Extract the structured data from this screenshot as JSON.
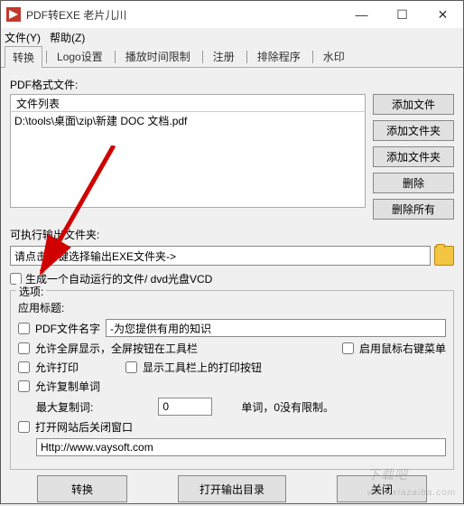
{
  "title": "PDF转EXE    老片儿川",
  "winbtns": {
    "min": "—",
    "max": "☐",
    "close": "✕"
  },
  "menu": {
    "file": "文件(Y)",
    "help": "帮助(Z)"
  },
  "tabs": [
    "转换",
    "Logo设置",
    "播放时间限制",
    "注册",
    "排除程序",
    "水印"
  ],
  "section1_label": "PDF格式文件:",
  "file_list_header": "文件列表",
  "file_list_items": [
    "D:\\tools\\桌面\\zip\\新建 DOC 文档.pdf"
  ],
  "side_buttons": [
    "添加文件",
    "添加文件夹",
    "添加文件夹",
    "删除",
    "删除所有"
  ],
  "output_label": "可执行输出文件夹:",
  "output_value": "请点击右键选择输出EXE文件夹->",
  "autorun_label": "生成一个自动运行的文件/ dvd光盘VCD",
  "options_legend": "选项:",
  "apply_title": "应用标题:",
  "pdf_name_label": "PDF文件名字",
  "pdf_name_value": "-为您提供有用的知识",
  "fullscreen_label": "允许全屏显示，全屏按钮在工具栏",
  "rightclick_label": "启用鼠标右键菜单",
  "allow_print": "允许打印",
  "show_print_btn": "显示工具栏上的打印按钮",
  "allow_copy": "允许复制单词",
  "max_copy_label": "最大复制词:",
  "max_copy_value": "0",
  "max_copy_suffix": "单词，0没有限制。",
  "open_web_label": "打开网站后关闭窗口",
  "url_value": "Http://www.vaysoft.com",
  "bottom": {
    "convert": "转换",
    "open_dir": "打开输出目录",
    "close": "关闭"
  },
  "watermark": "下载吧\nwww.xiazaiba.com"
}
